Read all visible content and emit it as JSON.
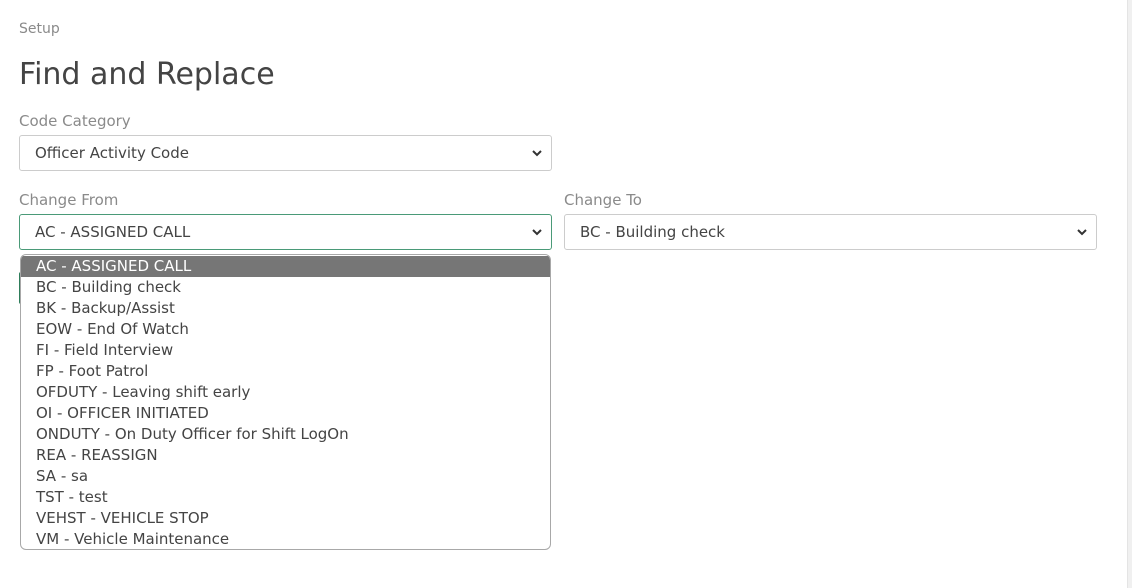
{
  "breadcrumb": "Setup",
  "title": "Find and Replace",
  "code_category": {
    "label": "Code Category",
    "value": "Officer Activity Code"
  },
  "change_from": {
    "label": "Change From",
    "value": "AC - ASSIGNED CALL"
  },
  "change_to": {
    "label": "Change To",
    "value": "BC - Building check"
  },
  "dropdown_options": [
    "AC - ASSIGNED CALL",
    "BC - Building check",
    "BK - Backup/Assist",
    "EOW - End Of Watch",
    "FI - Field Interview",
    "FP - Foot Patrol",
    "OFDUTY - Leaving shift early",
    "OI - OFFICER INITIATED",
    "ONDUTY - On Duty Officer for Shift LogOn",
    "REA - REASSIGN",
    "SA - sa",
    "TST - test",
    "VEHST - VEHICLE STOP",
    "VM - Vehicle Maintenance"
  ],
  "selected_index": 0,
  "colors": {
    "focus_border": "#4a9a78",
    "selected_bg": "#767676",
    "accent": "#2e7d5a"
  }
}
